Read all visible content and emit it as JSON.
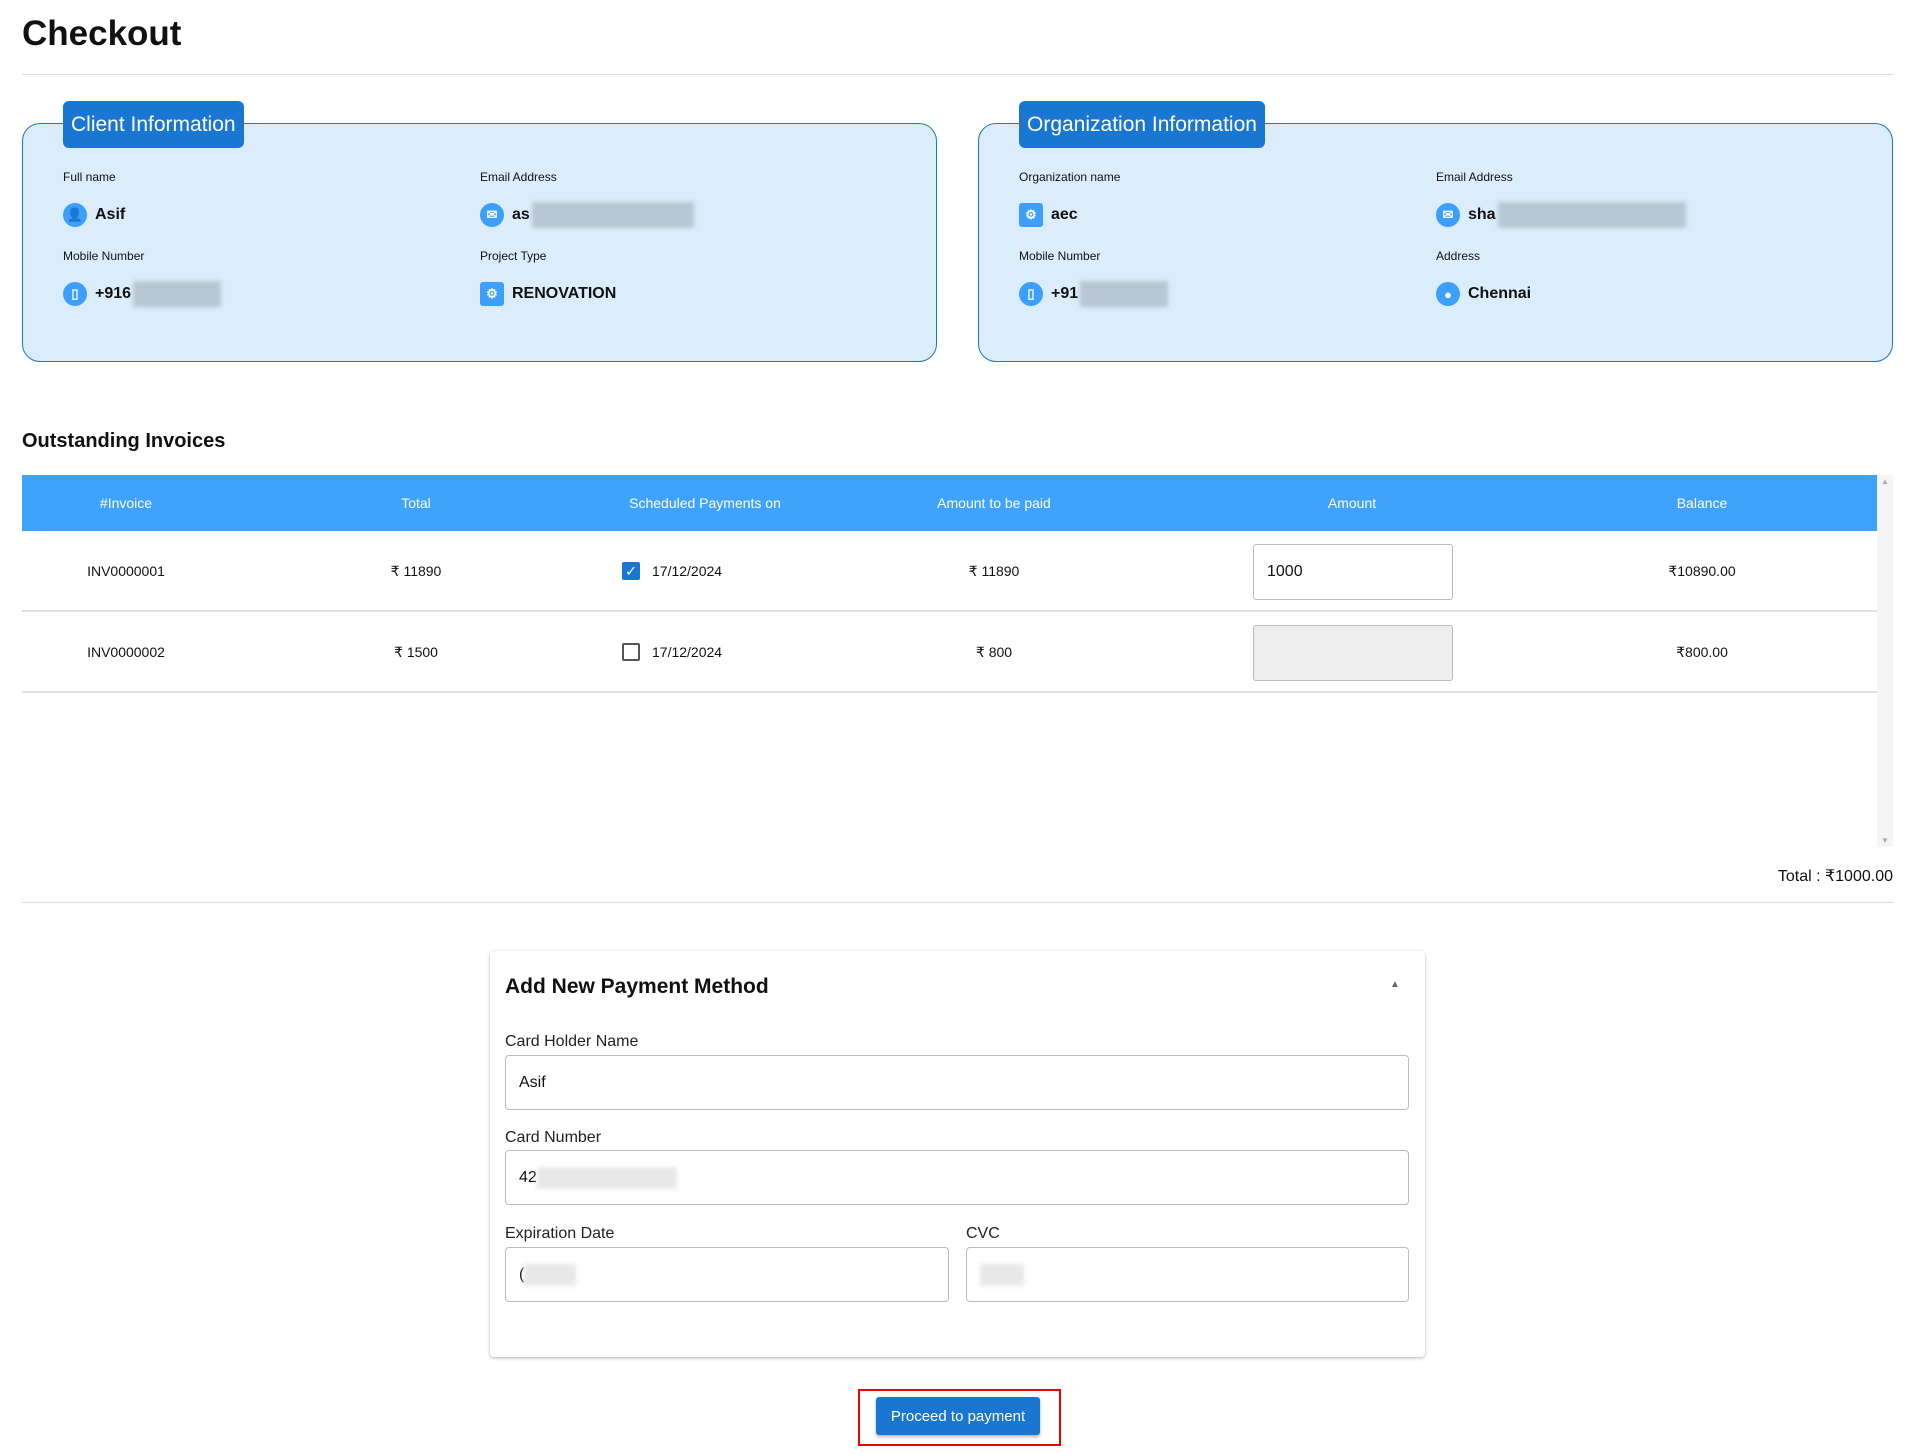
{
  "title": "Checkout",
  "client": {
    "tab": "Client Information",
    "full_name_label": "Full name",
    "full_name": "Asif",
    "email_label": "Email Address",
    "email_partial": "as",
    "mobile_label": "Mobile Number",
    "mobile_partial": "+916",
    "project_type_label": "Project Type",
    "project_type": "RENOVATION"
  },
  "org": {
    "tab": "Organization Information",
    "name_label": "Organization name",
    "name": "aec",
    "email_label": "Email Address",
    "email_partial": "sha",
    "mobile_label": "Mobile Number",
    "mobile_partial": "+91",
    "address_label": "Address",
    "address": "Chennai"
  },
  "invoices": {
    "title": "Outstanding Invoices",
    "headers": [
      "#Invoice",
      "Total",
      "Scheduled Payments on",
      "Amount to be paid",
      "Amount",
      "Balance"
    ],
    "rows": [
      {
        "invoice": "INV0000001",
        "total": "₹ 11890",
        "checked": true,
        "date": "17/12/2024",
        "to_pay": "₹ 11890",
        "amount": "1000",
        "balance": "₹10890.00"
      },
      {
        "invoice": "INV0000002",
        "total": "₹ 1500",
        "checked": false,
        "date": "17/12/2024",
        "to_pay": "₹ 800",
        "amount": "",
        "balance": "₹800.00"
      }
    ],
    "total": "Total : ₹1000.00"
  },
  "payment": {
    "title": "Add New Payment Method",
    "holder_label": "Card Holder Name",
    "holder": "Asif",
    "number_label": "Card Number",
    "number_partial": "42",
    "exp_label": "Expiration Date",
    "exp_partial": "(",
    "cvc_label": "CVC",
    "button": "Proceed to payment"
  }
}
